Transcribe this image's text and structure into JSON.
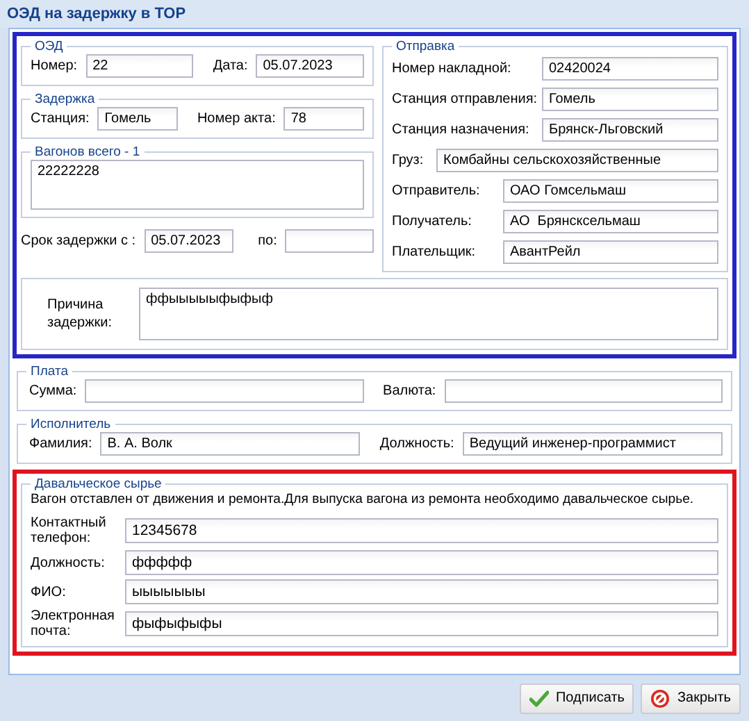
{
  "window": {
    "title": "ОЭД на задержку в ТОР"
  },
  "oed": {
    "legend": "ОЭД",
    "fields": [
      {
        "label": "Номер:",
        "value": "22"
      },
      {
        "label": "Дата:",
        "value": "05.07.2023"
      }
    ]
  },
  "delay": {
    "legend": "Задержка",
    "fields": [
      {
        "label": "Станция:",
        "value": "Гомель"
      },
      {
        "label": "Номер акта:",
        "value": "78"
      }
    ]
  },
  "wagons": {
    "legend": "Вагонов всего - 1",
    "value": "22222228"
  },
  "delay_period": {
    "from_label": "Срок задержки с :",
    "from_value": "05.07.2023",
    "to_label": "по:"
  },
  "reason": {
    "label": "Причина задержки:",
    "value": "ффыыыыыфыфыф"
  },
  "shipment": {
    "legend": "Отправка",
    "fields": [
      {
        "label": "Номер накладной:",
        "value": "02420024"
      },
      {
        "label": "Станция отправления:",
        "value": "Гомель"
      },
      {
        "label": "Станция назначения:",
        "value": "Брянск-Льговский"
      },
      {
        "label": "Груз:",
        "value": "Комбайны сельскохозяйственные"
      },
      {
        "label": "Отправитель:",
        "value": "ОАО Гомсельмаш"
      },
      {
        "label": "Получатель:",
        "value": "АО  Брянсксельмаш"
      },
      {
        "label": "Плательщик:",
        "value": "АвантРейл"
      }
    ]
  },
  "payment": {
    "legend": "Плата",
    "fields": [
      {
        "label": "Сумма:"
      },
      {
        "label": "Валюта:"
      }
    ]
  },
  "executor": {
    "legend": "Исполнитель",
    "fields": [
      {
        "label": "Фамилия:",
        "value": "В. А. Волк"
      },
      {
        "label": "Должность:",
        "value": "Ведущий инженер-программист"
      }
    ]
  },
  "raw_material": {
    "legend": "Давальческое сырье",
    "notice": "Вагон отставлен от движения и ремонта.Для выпуска вагона из ремонта необходимо давальческое сырье.",
    "fields": [
      {
        "label": "Контактный телефон:",
        "value": "12345678"
      },
      {
        "label": "Должность:",
        "value": "ффффф"
      },
      {
        "label": "ФИО:",
        "value": "ыыыыыыы"
      },
      {
        "label": "Электронная почта:",
        "value": "фыфыфыфы"
      }
    ]
  },
  "buttons": [
    {
      "label": "Подписать",
      "kind": "sign"
    },
    {
      "label": "Закрыть",
      "kind": "close"
    }
  ]
}
